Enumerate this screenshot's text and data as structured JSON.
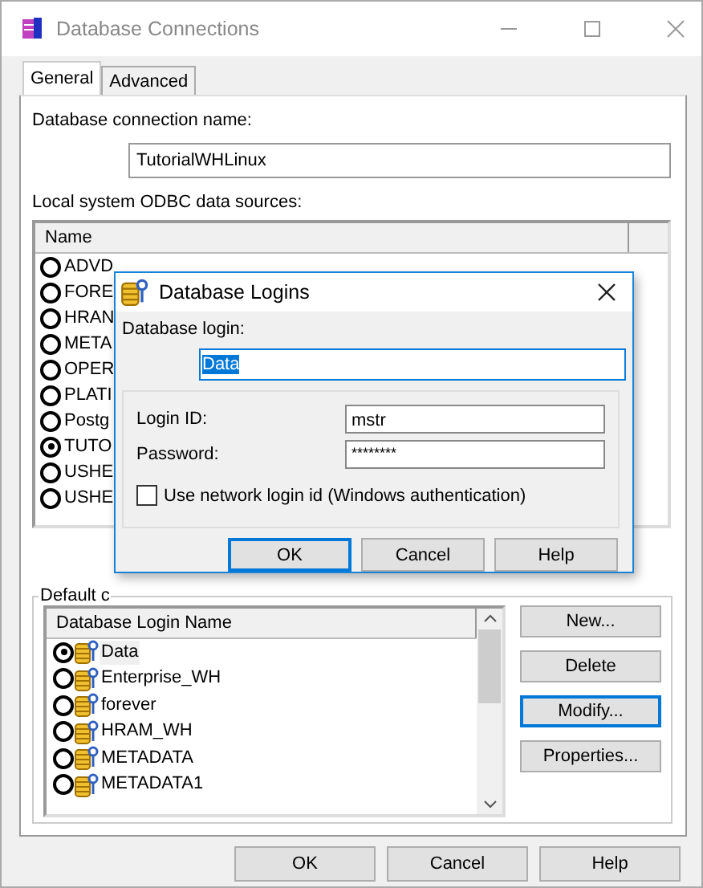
{
  "window": {
    "title": "Database Connections"
  },
  "tabs": [
    {
      "label": "General",
      "selected": true
    },
    {
      "label": "Advanced",
      "selected": false
    }
  ],
  "connection_name": {
    "label": "Database connection name:",
    "value": "TutorialWHLinux"
  },
  "odbc_sources": {
    "label": "Local system ODBC data sources:",
    "column": "Name",
    "rows": [
      {
        "name": "ADVD",
        "selected": false
      },
      {
        "name": "FORE",
        "selected": false
      },
      {
        "name": "HRAN",
        "selected": false
      },
      {
        "name": "META",
        "selected": false
      },
      {
        "name": "OPER",
        "selected": false
      },
      {
        "name": "PLATI",
        "selected": false
      },
      {
        "name": "Postg",
        "selected": false
      },
      {
        "name": "TUTO",
        "selected": true
      },
      {
        "name": "USHE",
        "selected": false
      },
      {
        "name": "USHE",
        "selected": false
      }
    ]
  },
  "default_login": {
    "group_label": "Default c",
    "column": "Database Login Name",
    "rows": [
      {
        "name": "Data",
        "selected": true
      },
      {
        "name": "Enterprise_WH",
        "selected": false
      },
      {
        "name": "forever",
        "selected": false
      },
      {
        "name": "HRAM_WH",
        "selected": false
      },
      {
        "name": "METADATA",
        "selected": false
      },
      {
        "name": "METADATA1",
        "selected": false
      }
    ],
    "buttons": [
      {
        "label": "New...",
        "focused": false
      },
      {
        "label": "Delete",
        "focused": false
      },
      {
        "label": "Modify...",
        "focused": true
      },
      {
        "label": "Properties...",
        "focused": false
      }
    ]
  },
  "buttons": [
    {
      "label": "OK",
      "focused": false
    },
    {
      "label": "Cancel",
      "focused": false
    },
    {
      "label": "Help",
      "focused": false
    }
  ],
  "dialog": {
    "title": "Database Logins",
    "login_label": "Database login:",
    "login_value": "Data",
    "login_id": {
      "label": "Login ID:",
      "value": "mstr"
    },
    "password": {
      "label": "Password:",
      "value": "********"
    },
    "network_login": {
      "label": "Use network login id (Windows authentication)",
      "checked": false
    },
    "buttons": [
      {
        "label": "OK",
        "focused": true
      },
      {
        "label": "Cancel",
        "focused": false
      },
      {
        "label": "Help",
        "focused": false
      }
    ]
  }
}
